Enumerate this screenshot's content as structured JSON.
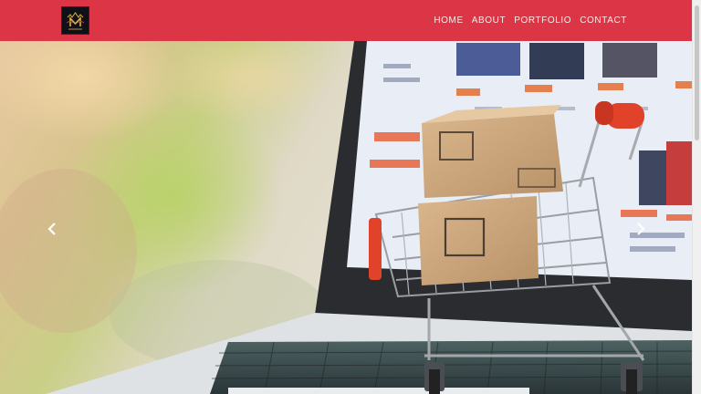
{
  "brand": {
    "logo_icon": "crown-monogram-logo"
  },
  "nav": {
    "items": [
      {
        "label": "HOME"
      },
      {
        "label": "ABOUT"
      },
      {
        "label": "PORTFOLIO"
      },
      {
        "label": "CONTACT"
      }
    ]
  },
  "carousel": {
    "image": "shopping-cart-with-boxes-on-laptop",
    "prev_icon": "chevron-left-icon",
    "next_icon": "chevron-right-icon"
  },
  "colors": {
    "navbar": "#dc3545",
    "nav_text": "#ffe9ea",
    "cart_handle": "#e0432a",
    "box": "#c9a57c"
  }
}
